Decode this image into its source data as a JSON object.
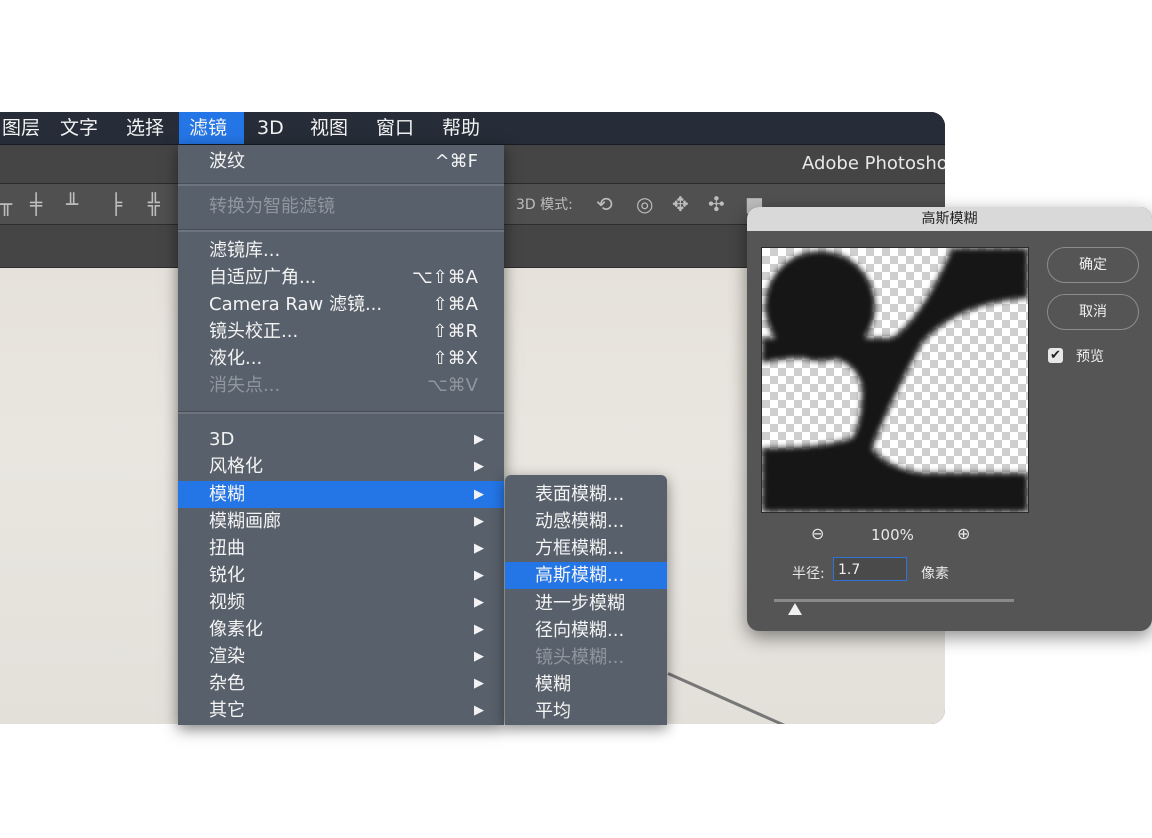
{
  "menubar": [
    "图层",
    "文字",
    "选择",
    "滤镜",
    "3D",
    "视图",
    "窗口",
    "帮助"
  ],
  "titlebar": {
    "app_title": "Adobe Photoshop"
  },
  "optionsbar": {
    "mode_label": "3D 模式:"
  },
  "filter_menu": {
    "last_filter": {
      "label": "波纹",
      "shortcut": "^⌘F"
    },
    "convert_smart": "转换为智能滤镜",
    "group2": [
      {
        "label": "滤镜库...",
        "shortcut": ""
      },
      {
        "label": "自适应广角...",
        "shortcut": "⌥⇧⌘A"
      },
      {
        "label": "Camera Raw 滤镜...",
        "shortcut": "⇧⌘A"
      },
      {
        "label": "镜头校正...",
        "shortcut": "⇧⌘R"
      },
      {
        "label": "液化...",
        "shortcut": "⇧⌘X"
      },
      {
        "label": "消失点...",
        "shortcut": "⌥⌘V"
      }
    ],
    "submenus": [
      "3D",
      "风格化",
      "模糊",
      "模糊画廊",
      "扭曲",
      "锐化",
      "视频",
      "像素化",
      "渲染",
      "杂色",
      "其它"
    ],
    "arrow": "▶"
  },
  "blur_submenu": [
    "表面模糊...",
    "动感模糊...",
    "方框模糊...",
    "高斯模糊...",
    "进一步模糊",
    "径向模糊...",
    "镜头模糊...",
    "模糊",
    "平均"
  ],
  "dialog": {
    "title": "高斯模糊",
    "ok": "确定",
    "cancel": "取消",
    "preview_label": "预览",
    "preview_checked": true,
    "zoom": "100%",
    "radius_label": "半径:",
    "radius_value": "1.7",
    "unit": "像素",
    "zoom_out_icon": "zoom-out-icon",
    "zoom_in_icon": "zoom-in-icon"
  }
}
